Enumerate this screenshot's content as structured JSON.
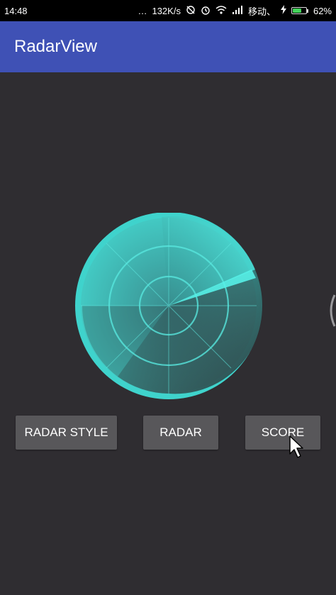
{
  "status_bar": {
    "time": "14:48",
    "dots": "…",
    "network_speed": "132K/s",
    "carrier": "移动、",
    "battery_percent": "62%",
    "battery_level": 0.62
  },
  "app_bar": {
    "title": "RadarView"
  },
  "radar": {
    "accent_color": "#4ae6dd",
    "sweep_color": "#56f1e8"
  },
  "buttons": {
    "radar_style": "RADAR STYLE",
    "radar": "RADAR",
    "score": "SCORE"
  },
  "colors": {
    "background": "#2f2d31",
    "app_bar": "#3f51b5",
    "button": "#58575a"
  }
}
